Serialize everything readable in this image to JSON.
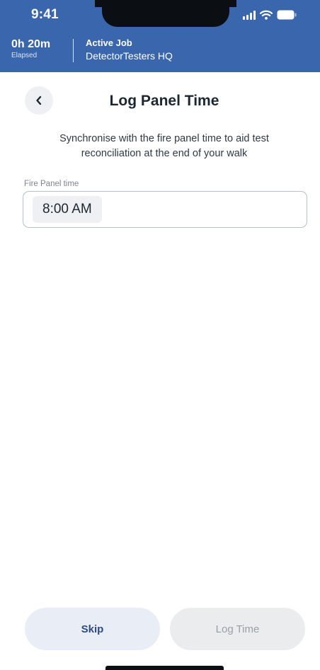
{
  "status_bar": {
    "time": "9:41",
    "icons": [
      "signal-icon",
      "wifi-icon",
      "battery-icon"
    ]
  },
  "job_bar": {
    "elapsed_value": "0h 20m",
    "elapsed_label": "Elapsed",
    "job_title": "Active Job",
    "job_name": "DetectorTesters HQ"
  },
  "page": {
    "title": "Log Panel Time",
    "description": "Synchronise with the fire panel time to aid test reconciliation at the end of your walk",
    "back_icon": "chevron-left-icon"
  },
  "field": {
    "label": "Fire Panel time",
    "value": "8:00 AM"
  },
  "actions": {
    "skip_label": "Skip",
    "log_time_label": "Log Time",
    "log_time_enabled": false
  },
  "colors": {
    "header_blue": "#3a66ae",
    "skip_bg": "#e9edf6",
    "skip_text": "#2c4b86",
    "disabled_bg": "#ebecee",
    "disabled_text": "#9a9fa6"
  }
}
